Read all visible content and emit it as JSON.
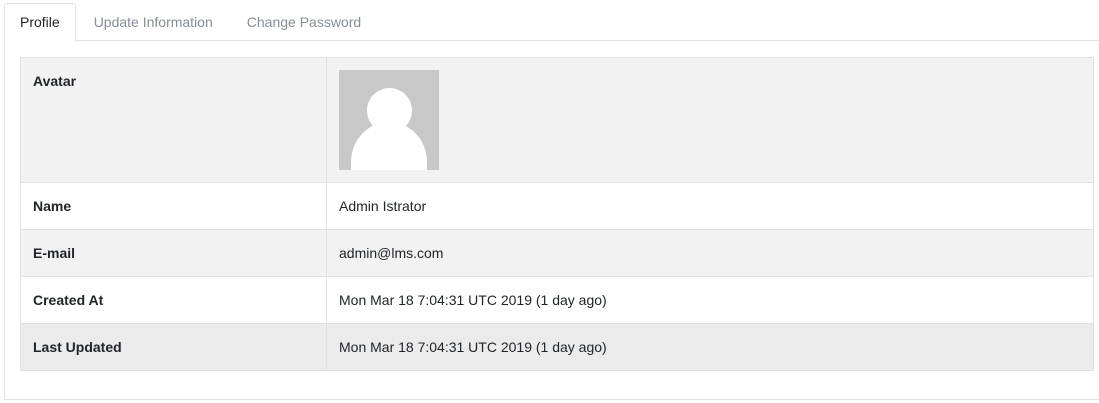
{
  "tabs": [
    {
      "label": "Profile",
      "active": true
    },
    {
      "label": "Update Information",
      "active": false
    },
    {
      "label": "Change Password",
      "active": false
    }
  ],
  "profile": {
    "rows": [
      {
        "label": "Avatar",
        "value": ""
      },
      {
        "label": "Name",
        "value": "Admin Istrator"
      },
      {
        "label": "E-mail",
        "value": "admin@lms.com"
      },
      {
        "label": "Created At",
        "value": "Mon Mar 18 7:04:31 UTC 2019 (1 day ago)"
      },
      {
        "label": "Last Updated",
        "value": "Mon Mar 18 7:04:31 UTC 2019 (1 day ago)"
      }
    ]
  },
  "colors": {
    "border": "#dee2e6",
    "row_alt_bg": "#f2f2f2",
    "avatar_bg": "#c8c8c8",
    "tab_inactive_text": "#868e96"
  },
  "icons": {
    "avatar": "default-user-avatar-icon"
  }
}
